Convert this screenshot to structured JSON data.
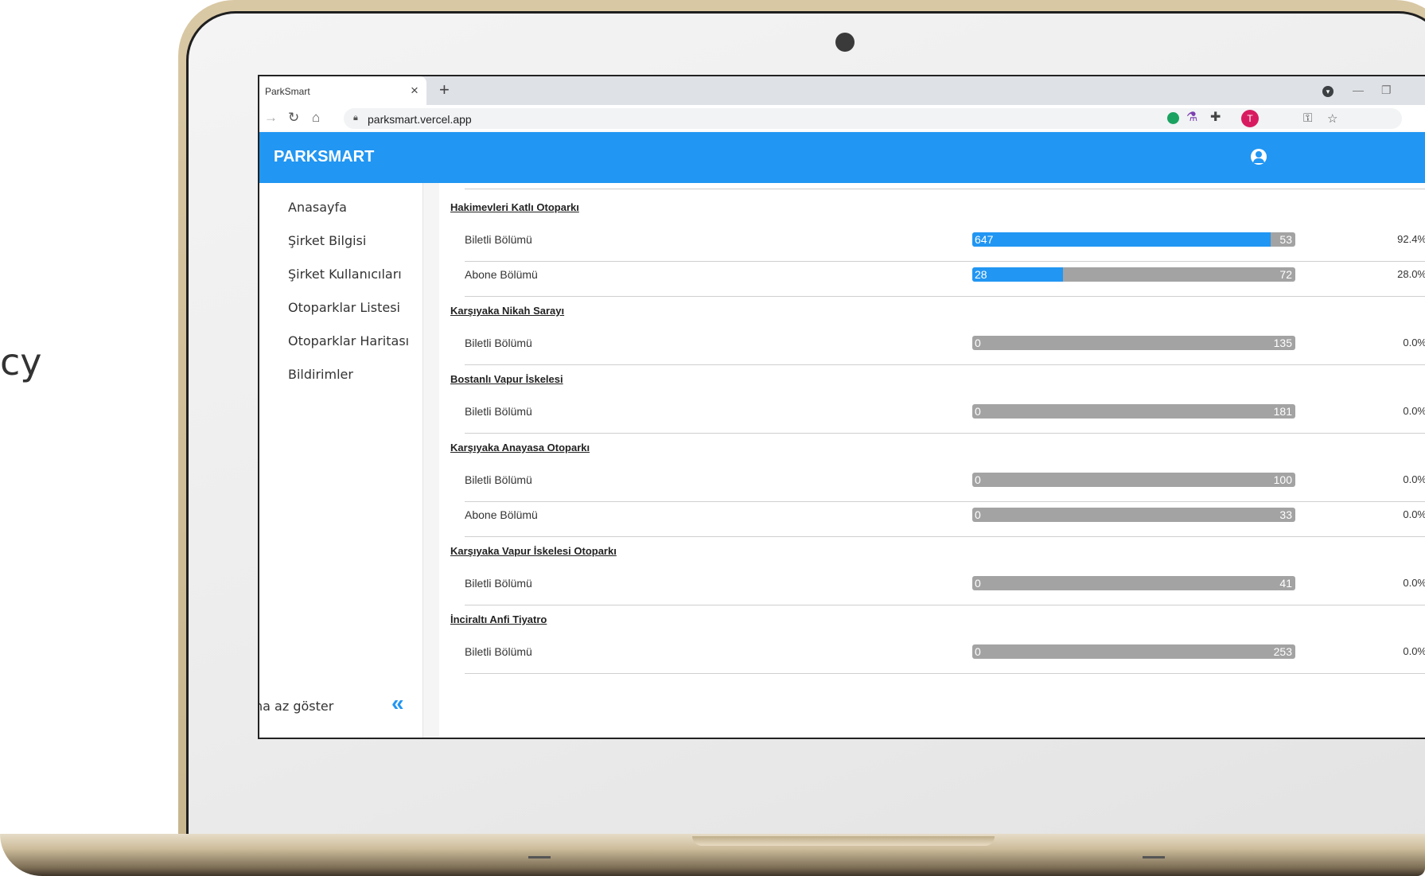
{
  "side_fragment": "cy",
  "browser": {
    "tab_title": "ParkSmart",
    "tab_close": "×",
    "new_tab": "+",
    "url": "parksmart.vercel.app",
    "profile_initial": "T"
  },
  "app": {
    "brand": "PARKSMART"
  },
  "sidebar": {
    "items": [
      {
        "label": "Anasayfa"
      },
      {
        "label": "Şirket Bilgisi"
      },
      {
        "label": "Şirket Kullanıcıları"
      },
      {
        "label": "Otoparklar Listesi"
      },
      {
        "label": "Otoparklar Haritası"
      },
      {
        "label": "Bildirimler"
      }
    ],
    "collapse_label": "ha az göster",
    "collapse_icon": "«"
  },
  "lots": [
    {
      "name": "Hakimevleri Katlı Otoparkı",
      "sections": [
        {
          "label": "Biletli Bölümü",
          "used": "647",
          "free": "53",
          "occupancy": 0.924,
          "percent": "92.4%"
        },
        {
          "label": "Abone Bölümü",
          "used": "28",
          "free": "72",
          "occupancy": 0.28,
          "percent": "28.0%"
        }
      ]
    },
    {
      "name": "Karşıyaka Nikah Sarayı",
      "sections": [
        {
          "label": "Biletli Bölümü",
          "used": "0",
          "free": "135",
          "occupancy": 0,
          "percent": "0.0%"
        }
      ]
    },
    {
      "name": "Bostanlı Vapur İskelesi",
      "sections": [
        {
          "label": "Biletli Bölümü",
          "used": "0",
          "free": "181",
          "occupancy": 0,
          "percent": "0.0%"
        }
      ]
    },
    {
      "name": "Karşıyaka Anayasa Otoparkı",
      "sections": [
        {
          "label": "Biletli Bölümü",
          "used": "0",
          "free": "100",
          "occupancy": 0,
          "percent": "0.0%"
        },
        {
          "label": "Abone Bölümü",
          "used": "0",
          "free": "33",
          "occupancy": 0,
          "percent": "0.0%"
        }
      ]
    },
    {
      "name": "Karşıyaka Vapur İskelesi Otoparkı",
      "sections": [
        {
          "label": "Biletli Bölümü",
          "used": "0",
          "free": "41",
          "occupancy": 0,
          "percent": "0.0%"
        }
      ]
    },
    {
      "name": "İnciraltı Anfi Tiyatro",
      "sections": [
        {
          "label": "Biletli Bölümü",
          "used": "0",
          "free": "253",
          "occupancy": 0,
          "percent": "0.0%"
        }
      ]
    }
  ],
  "colors": {
    "appbar": "#2196f3",
    "bar_used": "#2196f3",
    "bar_free": "#a3a3a3"
  }
}
